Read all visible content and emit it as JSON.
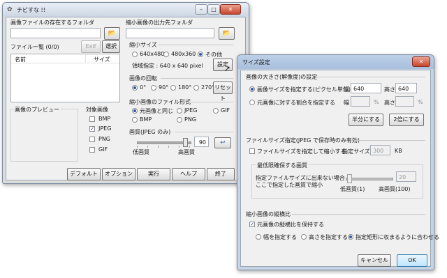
{
  "main": {
    "title": "チビすな !!",
    "source_folder_label": "画像ファイルの存在するフォルダ",
    "output_folder_label": "縮小画像の出力先フォルダ",
    "file_list_label": "ファイル一覧 (0/0)",
    "exif_button": "Exif",
    "select_button": "選択",
    "col_name": "名前",
    "col_size": "サイズ",
    "preview_label": "画像のプレビュー",
    "target_label": "対象画像",
    "targets": [
      {
        "label": "BMP",
        "checked": false
      },
      {
        "label": "JPEG",
        "checked": true
      },
      {
        "label": "PNG",
        "checked": false
      },
      {
        "label": "GIF",
        "checked": false
      }
    ],
    "resize_label": "縮小サイズ",
    "sizes": [
      "640x480",
      "480x360",
      "その他"
    ],
    "region_text": "領域指定 : 640 x 640 pixel",
    "settings_button": "設定",
    "rotation_label": "画像の回転",
    "rotations": [
      "0°",
      "90°",
      "180°",
      "270°"
    ],
    "reset_button": "リセット",
    "format_label": "縮小画像のファイル形式",
    "formats": [
      "元画像と同じ",
      "JPEG",
      "GIF",
      "BMP",
      "PNG"
    ],
    "quality_label": "画質(JPEG のみ)",
    "quality_value": "90",
    "quality_low": "低画質",
    "quality_high": "高画質",
    "buttons": [
      "デフォルト",
      "オプション",
      "実行",
      "ヘルプ",
      "終了"
    ]
  },
  "dialog": {
    "title": "サイズ設定",
    "size_section": "画像の大きさ(解像度)の設定",
    "pixel_radio": "画像サイズを指定する(ピクセル単位)",
    "width_label": "幅",
    "width_value": "640",
    "height_label": "高さ",
    "height_value": "640",
    "ratio_radio": "元画像に対する割合を指定する",
    "percent": "%",
    "half_button": "半分にする",
    "double_button": "2倍にする",
    "filesize_section": "ファイルサイズ指定(JPEG で保存時のみ有効)",
    "filesize_check": "ファイルサイズを指定して縮小する",
    "filesize_label": "指定サイズ",
    "filesize_value": "300",
    "filesize_unit": "KB",
    "min_quality_label": "最低限確保する画質",
    "min_quality_note1": "指定ファイルサイズに出来ない場合",
    "min_quality_note2": "ここで指定した画質で縮小",
    "min_quality_value": "20",
    "min_quality_low": "低画質(1)",
    "min_quality_high": "高画質(100)",
    "aspect_section": "縮小画像の縦横比",
    "aspect_check": "元画像の縦横比を保持する",
    "aspect_options": [
      "幅を指定する",
      "高さを指定する",
      "指定矩形に収まるように合わせる"
    ],
    "cancel_button": "キャンセル",
    "ok_button": "OK"
  }
}
